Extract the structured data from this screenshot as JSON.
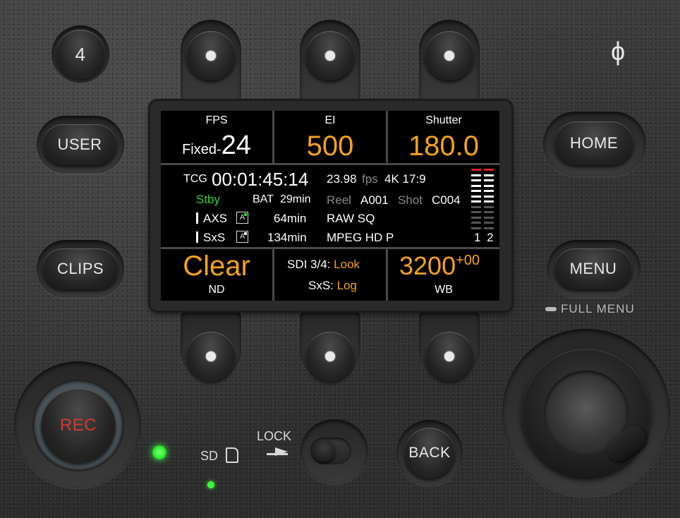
{
  "buttons": {
    "b4": "4",
    "user": "USER",
    "clips": "CLIPS",
    "home": "HOME",
    "menu": "MENU",
    "full_menu": "FULL MENU",
    "rec": "REC",
    "back": "BACK",
    "lock": "LOCK",
    "sd": "SD",
    "power": "ϕ"
  },
  "screen": {
    "fps": {
      "label": "FPS",
      "prefix": "Fixed-",
      "value": "24"
    },
    "ei": {
      "label": "EI",
      "value": "500"
    },
    "shutter": {
      "label": "Shutter",
      "value": "180.0"
    },
    "tcg": "TCG",
    "timecode": "00:01:45:14",
    "rate": "23.98",
    "rate_unit": "fps",
    "format": "4K 17:9",
    "status": "Stby",
    "bat_label": "BAT",
    "bat_value": "29min",
    "reel_label": "Reel",
    "reel_value": "A001",
    "shot_label": "Shot",
    "shot_value": "C004",
    "axs_label": "AXS",
    "axs_time": "64min",
    "axs_format": "RAW SQ",
    "sxs_label": "SxS",
    "sxs_time": "134min",
    "sxs_format": "MPEG HD P",
    "audio_ch": "1 2",
    "nd_value": "Clear",
    "nd_label": "ND",
    "sdi_label": "SDI 3/4:",
    "sdi_value": "Look",
    "sxs_out_label": "SxS:",
    "sxs_out_value": "Log",
    "wb_value": "3200",
    "wb_offset": "+00",
    "wb_label": "WB"
  },
  "colors": {
    "accent": "#f6a219",
    "status": "#3ad23a",
    "rec_text": "#d23a2e",
    "led": "#3cff3c",
    "meter_red": "#e02020"
  }
}
